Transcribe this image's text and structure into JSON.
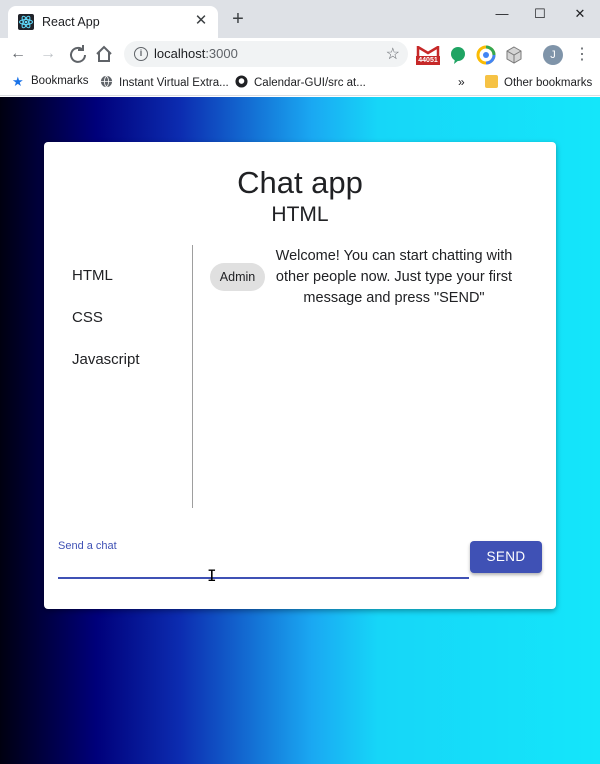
{
  "browser": {
    "tab_title": "React App",
    "new_tab_symbol": "+",
    "url_host": "localhost",
    "url_port": ":3000",
    "extension_badge": "44051",
    "profile_initial": "J",
    "bookmarks": [
      {
        "label": "Bookmarks",
        "icon": "star-icon"
      },
      {
        "label": "Instant Virtual Extra...",
        "icon": "globe-icon"
      },
      {
        "label": "Calendar-GUI/src at...",
        "icon": "github-icon"
      }
    ],
    "overflow_symbol": "»",
    "other_bookmarks": "Other bookmarks"
  },
  "app": {
    "title": "Chat app",
    "current_room": "HTML",
    "rooms": [
      "HTML",
      "CSS",
      "Javascript"
    ],
    "messages": [
      {
        "from": "Admin",
        "text": "Welcome! You can start chatting with other people now. Just type your first message and press \"SEND\""
      }
    ],
    "input": {
      "label": "Send a chat",
      "value": ""
    },
    "send_label": "SEND"
  },
  "colors": {
    "accent": "#3f51b5",
    "chip": "#e0e0e0",
    "gradient_start": "#000010",
    "gradient_end": "#14e6fa"
  }
}
